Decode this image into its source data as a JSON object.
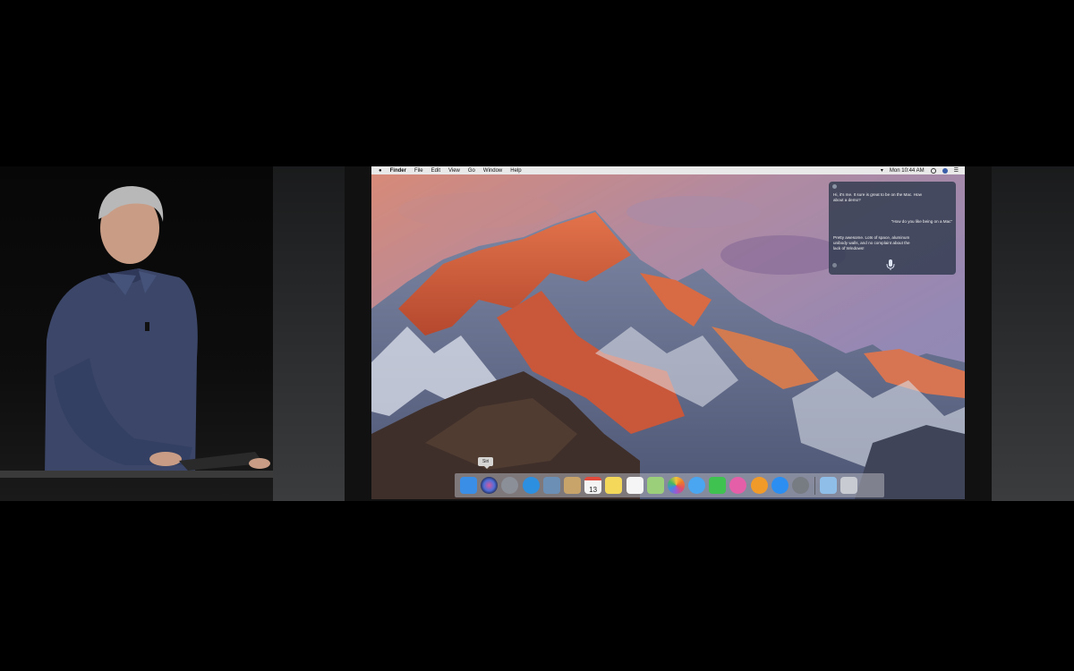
{
  "menubar": {
    "apple_icon": "apple-icon",
    "app_name": "Finder",
    "menus": [
      "File",
      "Edit",
      "View",
      "Go",
      "Window",
      "Help"
    ],
    "clock": "Mon 10:44 AM"
  },
  "siri": {
    "greeting": "Hi, it's me. It sure is great to be on the Mac. How about a demo?",
    "query": "“How do you like being on a Mac”",
    "response": "Pretty awesome. Lots of space, aluminum unibody walls, and no complaint about the lack of Windows!"
  },
  "dock": {
    "tooltip": "Siri",
    "calendar_day": "13",
    "apps": [
      {
        "name": "finder-icon",
        "color": "#3b8ee6"
      },
      {
        "name": "siri-icon",
        "color": "#2a2e55"
      },
      {
        "name": "launchpad-icon",
        "color": "#8b8f97"
      },
      {
        "name": "safari-icon",
        "color": "#2c8fe0"
      },
      {
        "name": "mail-icon",
        "color": "#6c8fb5"
      },
      {
        "name": "contacts-icon",
        "color": "#c9a46a"
      },
      {
        "name": "calendar-icon",
        "color": "#f4f4f4"
      },
      {
        "name": "notes-icon",
        "color": "#f4d85a"
      },
      {
        "name": "reminders-icon",
        "color": "#f5f5f5"
      },
      {
        "name": "maps-icon",
        "color": "#9ccf7a"
      },
      {
        "name": "photos-icon",
        "color": "#f2f2f2"
      },
      {
        "name": "messages-icon",
        "color": "#4aa6f0"
      },
      {
        "name": "facetime-icon",
        "color": "#3fc24f"
      },
      {
        "name": "itunes-icon",
        "color": "#e55fa8"
      },
      {
        "name": "ibooks-icon",
        "color": "#f09a2a"
      },
      {
        "name": "app-store-icon",
        "color": "#2c8ef0"
      },
      {
        "name": "system-preferences-icon",
        "color": "#777b82"
      }
    ],
    "right_items": [
      {
        "name": "preview-icon",
        "color": "#8fbfe8"
      },
      {
        "name": "trash-icon",
        "color": "#c8ccd2"
      }
    ]
  }
}
